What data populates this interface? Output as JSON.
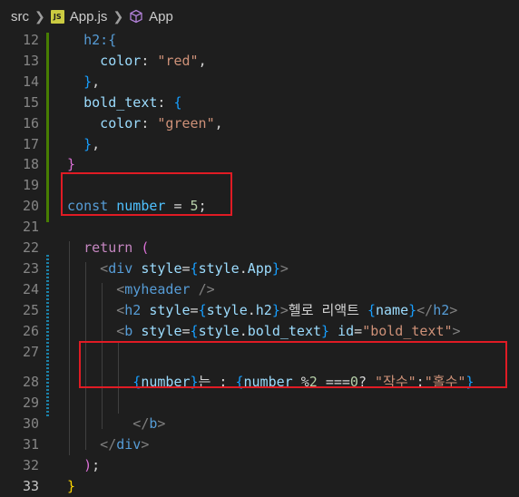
{
  "breadcrumb": {
    "folder": "src",
    "file_icon_label": "JS",
    "file": "App.js",
    "symbol": "App"
  },
  "lines": [
    {
      "num": "12",
      "segs": [
        [
          "brace",
          "    h2:{"
        ]
      ]
    },
    {
      "num": "13",
      "segs": [
        [
          "var",
          "      color"
        ],
        [
          "plain",
          ": "
        ],
        [
          "str",
          "\"red\""
        ],
        [
          "plain",
          ","
        ]
      ]
    },
    {
      "num": "14",
      "segs": [
        [
          "br3",
          "    }"
        ],
        [
          "plain",
          ","
        ]
      ]
    },
    {
      "num": "15",
      "segs": [
        [
          "var",
          "    bold_text"
        ],
        [
          "plain",
          ": "
        ],
        [
          "br3",
          "{"
        ]
      ]
    },
    {
      "num": "16",
      "segs": [
        [
          "var",
          "      color"
        ],
        [
          "plain",
          ": "
        ],
        [
          "str",
          "\"green\""
        ],
        [
          "plain",
          ","
        ]
      ]
    },
    {
      "num": "17",
      "segs": [
        [
          "br3",
          "    }"
        ],
        [
          "plain",
          ","
        ]
      ]
    },
    {
      "num": "18",
      "segs": [
        [
          "br1",
          "  }"
        ]
      ]
    },
    {
      "num": "19",
      "segs": []
    },
    {
      "num": "20",
      "segs": [
        [
          "kw",
          "  const "
        ],
        [
          "const",
          "number"
        ],
        [
          "plain",
          " = "
        ],
        [
          "num",
          "5"
        ],
        [
          "plain",
          ";"
        ]
      ]
    },
    {
      "num": "21",
      "segs": []
    },
    {
      "num": "22",
      "segs": [
        [
          "ctrl",
          "    return "
        ],
        [
          "br1",
          "("
        ]
      ]
    },
    {
      "num": "23",
      "segs": [
        [
          "ang",
          "      <"
        ],
        [
          "tag",
          "div "
        ],
        [
          "var",
          "style"
        ],
        [
          "plain",
          "="
        ],
        [
          "br3",
          "{"
        ],
        [
          "var",
          "style"
        ],
        [
          "plain",
          "."
        ],
        [
          "var",
          "App"
        ],
        [
          "br3",
          "}"
        ],
        [
          "ang",
          ">"
        ]
      ]
    },
    {
      "num": "24",
      "segs": [
        [
          "ang",
          "        <"
        ],
        [
          "tag",
          "myheader "
        ],
        [
          "ang",
          "/>"
        ]
      ]
    },
    {
      "num": "25",
      "segs": [
        [
          "ang",
          "        <"
        ],
        [
          "tag",
          "h2 "
        ],
        [
          "var",
          "style"
        ],
        [
          "plain",
          "="
        ],
        [
          "br3",
          "{"
        ],
        [
          "var",
          "style"
        ],
        [
          "plain",
          "."
        ],
        [
          "var",
          "h2"
        ],
        [
          "br3",
          "}"
        ],
        [
          "ang",
          ">"
        ],
        [
          "plain",
          "헬로 리액트 "
        ],
        [
          "br3",
          "{"
        ],
        [
          "var",
          "name"
        ],
        [
          "br3",
          "}"
        ],
        [
          "ang",
          "</"
        ],
        [
          "tag",
          "h2"
        ],
        [
          "ang",
          ">"
        ]
      ]
    },
    {
      "num": "26",
      "segs": [
        [
          "ang",
          "        <"
        ],
        [
          "tag",
          "b "
        ],
        [
          "var",
          "style"
        ],
        [
          "plain",
          "="
        ],
        [
          "br3",
          "{"
        ],
        [
          "var",
          "style"
        ],
        [
          "plain",
          "."
        ],
        [
          "var",
          "bold_text"
        ],
        [
          "br3",
          "} "
        ],
        [
          "var",
          "id"
        ],
        [
          "plain",
          "="
        ],
        [
          "str",
          "\"bold_text\""
        ],
        [
          "ang",
          ">"
        ]
      ]
    },
    {
      "num": "27",
      "segs": []
    },
    {
      "num": "28",
      "segs": [
        [
          "br3",
          "          {"
        ],
        [
          "var",
          "number"
        ],
        [
          "br3",
          "}"
        ],
        [
          "plain",
          "는 : "
        ],
        [
          "br3",
          "{"
        ],
        [
          "var",
          "number "
        ],
        [
          "plain",
          "%"
        ],
        [
          "num",
          "2 "
        ],
        [
          "plain",
          "==="
        ],
        [
          "num",
          "0"
        ],
        [
          "plain",
          "? "
        ],
        [
          "str",
          "\"작수\""
        ],
        [
          "plain",
          ":"
        ],
        [
          "str",
          "\"홀수\""
        ],
        [
          "br3",
          "}"
        ]
      ]
    },
    {
      "num": "29",
      "segs": []
    },
    {
      "num": "30",
      "segs": [
        [
          "ang",
          "          </"
        ],
        [
          "tag",
          "b"
        ],
        [
          "ang",
          ">"
        ]
      ]
    },
    {
      "num": "31",
      "segs": [
        [
          "ang",
          "      </"
        ],
        [
          "tag",
          "div"
        ],
        [
          "ang",
          ">"
        ]
      ]
    },
    {
      "num": "32",
      "segs": [
        [
          "br1",
          "    )"
        ],
        [
          "plain",
          ";"
        ]
      ]
    },
    {
      "num": "33",
      "segs": [
        [
          "br2",
          "  }"
        ]
      ]
    }
  ]
}
